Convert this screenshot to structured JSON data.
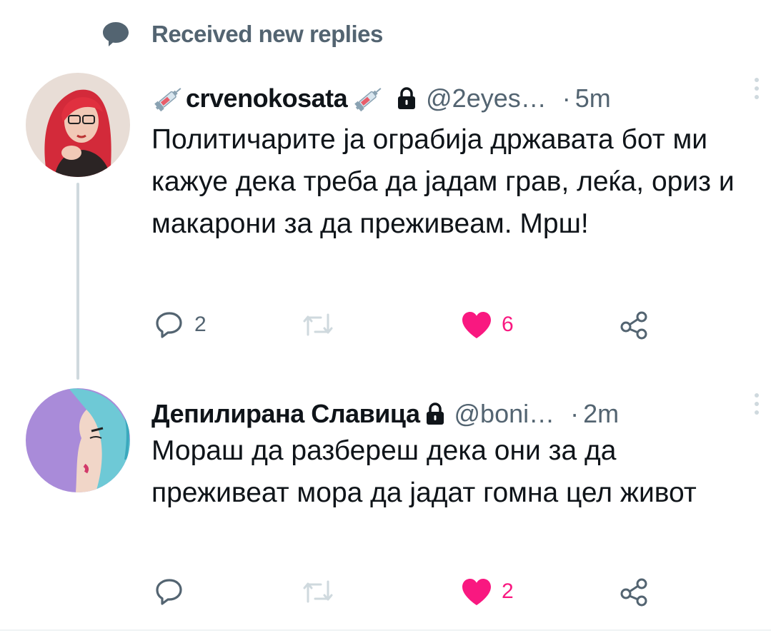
{
  "banner": {
    "text": "Received new replies",
    "icon": "speech-bubble-icon"
  },
  "tweets": [
    {
      "display_name": "crvenokosata",
      "name_emoji": "syringe-icon",
      "protected_icon": "lock-icon",
      "handle": "@2eyes…",
      "dot": "·",
      "time": "5m",
      "text": "Политичарите ја ограбија државата бот ми кажуе дека треба да јадам грав, леќа, ориз и макарони за да преживеам. Мрш!",
      "replies": "2",
      "retweets": "",
      "likes": "6",
      "liked": true
    },
    {
      "display_name": "Депилирана Славица",
      "protected_icon": "lock-icon",
      "handle": "@boni…",
      "dot": "·",
      "time": "2m",
      "text": "Мораш да разбереш дека они за да преживеат мора да јадат гомна цел живот",
      "replies": "",
      "retweets": "",
      "likes": "2",
      "liked": true
    }
  ],
  "colors": {
    "secondary_text": "#536471",
    "primary_text": "#0f1419",
    "like_pink": "#f91880",
    "thread_line": "#cfd9de",
    "retweet_icon": "#cfd9de"
  }
}
